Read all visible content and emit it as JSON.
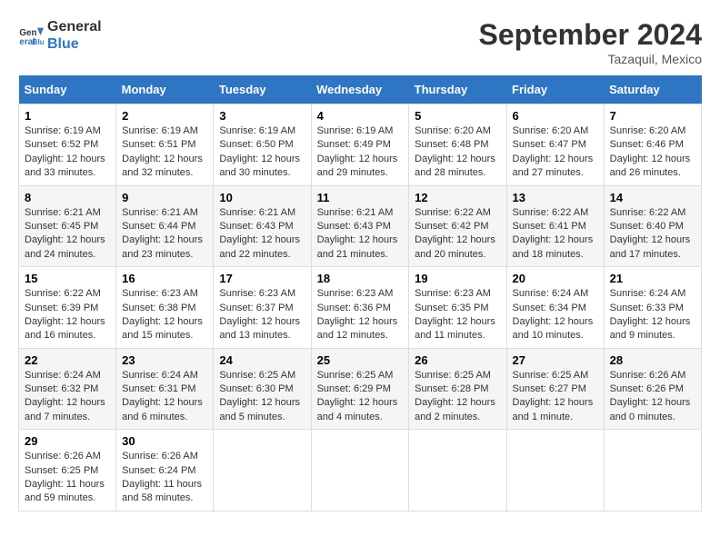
{
  "header": {
    "logo_line1": "General",
    "logo_line2": "Blue",
    "month": "September 2024",
    "location": "Tazaquil, Mexico"
  },
  "weekdays": [
    "Sunday",
    "Monday",
    "Tuesday",
    "Wednesday",
    "Thursday",
    "Friday",
    "Saturday"
  ],
  "weeks": [
    [
      {
        "day": "1",
        "sunrise": "6:19 AM",
        "sunset": "6:52 PM",
        "daylight": "12 hours and 33 minutes."
      },
      {
        "day": "2",
        "sunrise": "6:19 AM",
        "sunset": "6:51 PM",
        "daylight": "12 hours and 32 minutes."
      },
      {
        "day": "3",
        "sunrise": "6:19 AM",
        "sunset": "6:50 PM",
        "daylight": "12 hours and 30 minutes."
      },
      {
        "day": "4",
        "sunrise": "6:19 AM",
        "sunset": "6:49 PM",
        "daylight": "12 hours and 29 minutes."
      },
      {
        "day": "5",
        "sunrise": "6:20 AM",
        "sunset": "6:48 PM",
        "daylight": "12 hours and 28 minutes."
      },
      {
        "day": "6",
        "sunrise": "6:20 AM",
        "sunset": "6:47 PM",
        "daylight": "12 hours and 27 minutes."
      },
      {
        "day": "7",
        "sunrise": "6:20 AM",
        "sunset": "6:46 PM",
        "daylight": "12 hours and 26 minutes."
      }
    ],
    [
      {
        "day": "8",
        "sunrise": "6:21 AM",
        "sunset": "6:45 PM",
        "daylight": "12 hours and 24 minutes."
      },
      {
        "day": "9",
        "sunrise": "6:21 AM",
        "sunset": "6:44 PM",
        "daylight": "12 hours and 23 minutes."
      },
      {
        "day": "10",
        "sunrise": "6:21 AM",
        "sunset": "6:43 PM",
        "daylight": "12 hours and 22 minutes."
      },
      {
        "day": "11",
        "sunrise": "6:21 AM",
        "sunset": "6:43 PM",
        "daylight": "12 hours and 21 minutes."
      },
      {
        "day": "12",
        "sunrise": "6:22 AM",
        "sunset": "6:42 PM",
        "daylight": "12 hours and 20 minutes."
      },
      {
        "day": "13",
        "sunrise": "6:22 AM",
        "sunset": "6:41 PM",
        "daylight": "12 hours and 18 minutes."
      },
      {
        "day": "14",
        "sunrise": "6:22 AM",
        "sunset": "6:40 PM",
        "daylight": "12 hours and 17 minutes."
      }
    ],
    [
      {
        "day": "15",
        "sunrise": "6:22 AM",
        "sunset": "6:39 PM",
        "daylight": "12 hours and 16 minutes."
      },
      {
        "day": "16",
        "sunrise": "6:23 AM",
        "sunset": "6:38 PM",
        "daylight": "12 hours and 15 minutes."
      },
      {
        "day": "17",
        "sunrise": "6:23 AM",
        "sunset": "6:37 PM",
        "daylight": "12 hours and 13 minutes."
      },
      {
        "day": "18",
        "sunrise": "6:23 AM",
        "sunset": "6:36 PM",
        "daylight": "12 hours and 12 minutes."
      },
      {
        "day": "19",
        "sunrise": "6:23 AM",
        "sunset": "6:35 PM",
        "daylight": "12 hours and 11 minutes."
      },
      {
        "day": "20",
        "sunrise": "6:24 AM",
        "sunset": "6:34 PM",
        "daylight": "12 hours and 10 minutes."
      },
      {
        "day": "21",
        "sunrise": "6:24 AM",
        "sunset": "6:33 PM",
        "daylight": "12 hours and 9 minutes."
      }
    ],
    [
      {
        "day": "22",
        "sunrise": "6:24 AM",
        "sunset": "6:32 PM",
        "daylight": "12 hours and 7 minutes."
      },
      {
        "day": "23",
        "sunrise": "6:24 AM",
        "sunset": "6:31 PM",
        "daylight": "12 hours and 6 minutes."
      },
      {
        "day": "24",
        "sunrise": "6:25 AM",
        "sunset": "6:30 PM",
        "daylight": "12 hours and 5 minutes."
      },
      {
        "day": "25",
        "sunrise": "6:25 AM",
        "sunset": "6:29 PM",
        "daylight": "12 hours and 4 minutes."
      },
      {
        "day": "26",
        "sunrise": "6:25 AM",
        "sunset": "6:28 PM",
        "daylight": "12 hours and 2 minutes."
      },
      {
        "day": "27",
        "sunrise": "6:25 AM",
        "sunset": "6:27 PM",
        "daylight": "12 hours and 1 minute."
      },
      {
        "day": "28",
        "sunrise": "6:26 AM",
        "sunset": "6:26 PM",
        "daylight": "12 hours and 0 minutes."
      }
    ],
    [
      {
        "day": "29",
        "sunrise": "6:26 AM",
        "sunset": "6:25 PM",
        "daylight": "11 hours and 59 minutes."
      },
      {
        "day": "30",
        "sunrise": "6:26 AM",
        "sunset": "6:24 PM",
        "daylight": "11 hours and 58 minutes."
      },
      null,
      null,
      null,
      null,
      null
    ]
  ]
}
